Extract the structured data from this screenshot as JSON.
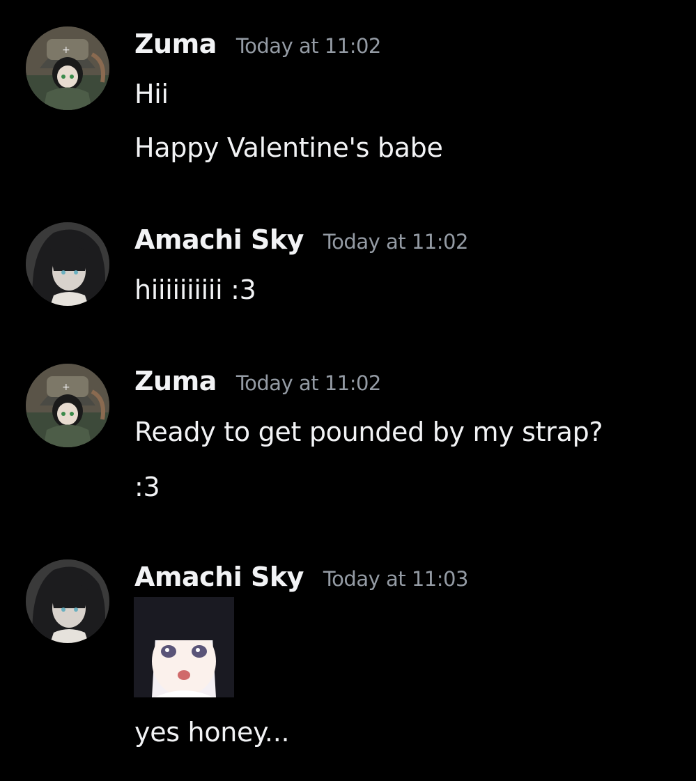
{
  "messages": [
    {
      "author": "Zuma",
      "timestamp": "Today at 11:02",
      "avatar_icon": "zuma-avatar",
      "lines": [
        "Hii",
        "Happy Valentine's babe"
      ]
    },
    {
      "author": "Amachi Sky",
      "timestamp": "Today at 11:02",
      "avatar_icon": "amachi-avatar",
      "lines": [
        "hiiiiiiiiii :3"
      ]
    },
    {
      "author": "Zuma",
      "timestamp": "Today at 11:02",
      "avatar_icon": "zuma-avatar",
      "lines": [
        "Ready to get pounded by my strap?",
        ":3"
      ]
    },
    {
      "author": "Amachi Sky",
      "timestamp": "Today at 11:03",
      "avatar_icon": "amachi-avatar",
      "sticker": "anime-girl-sticker",
      "lines": [
        "yes honey..."
      ]
    }
  ],
  "colors": {
    "background": "#000000",
    "username": "#f2f3f5",
    "timestamp": "#949ba4",
    "text": "#f2f3f5"
  }
}
